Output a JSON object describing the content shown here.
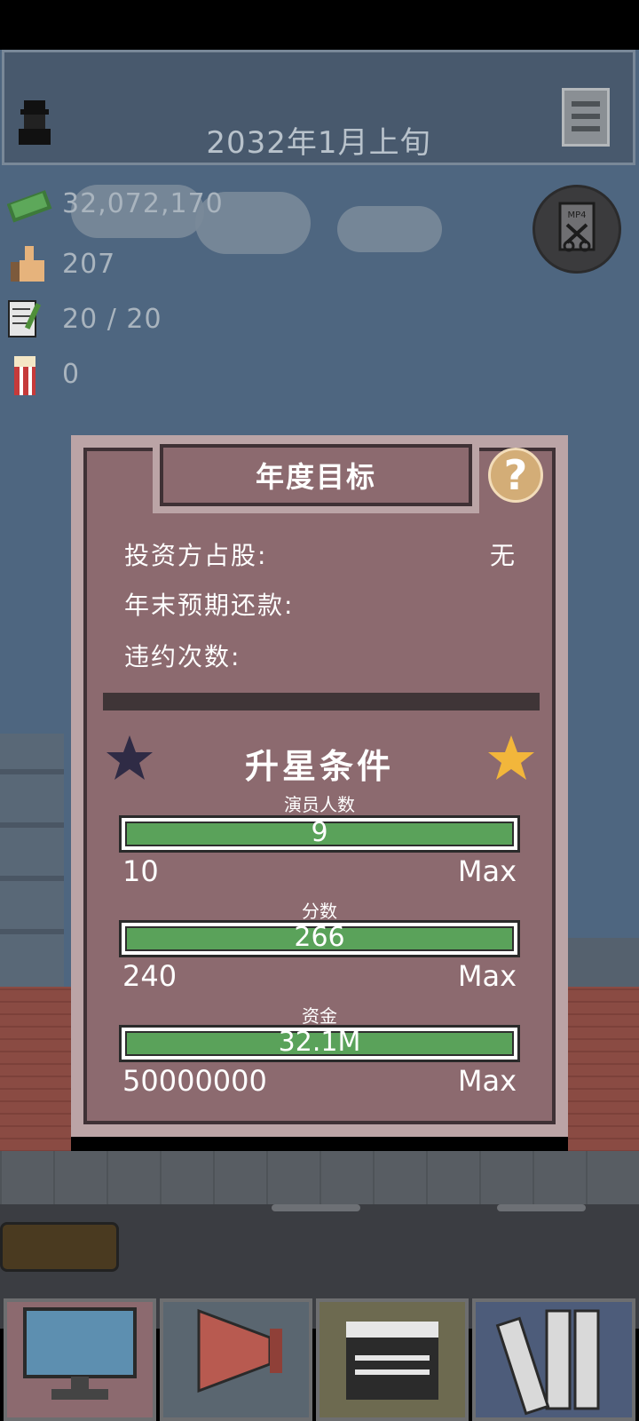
{
  "header": {
    "date": "2032年1月上旬"
  },
  "stats": {
    "money": "32,072,170",
    "likes": "207",
    "scripts": "20 / 20",
    "popcorn": "0"
  },
  "dialog": {
    "title": "年度目标",
    "help": "?",
    "rows": [
      {
        "label": "投资方占股:",
        "value": "无"
      },
      {
        "label": "年末预期还款:",
        "value": ""
      },
      {
        "label": "违约次数:",
        "value": ""
      }
    ],
    "upgrade_title": "升星条件",
    "conditions": [
      {
        "label": "演员人数",
        "current": "9",
        "min": "10",
        "max": "Max",
        "progress": 1.0
      },
      {
        "label": "分数",
        "current": "266",
        "min": "240",
        "max": "Max",
        "progress": 1.0
      },
      {
        "label": "资金",
        "current": "32.1M",
        "min": "50000000",
        "max": "Max",
        "progress": 1.0
      }
    ]
  },
  "colors": {
    "panel": "#8c6a6f",
    "panel_border": "#bba4a6",
    "progress_fill": "#5aa25a",
    "star_empty": "#2f2b45",
    "star_filled": "#f2b63b"
  },
  "bottom_nav": [
    {
      "icon": "computer-icon"
    },
    {
      "icon": "megaphone-icon"
    },
    {
      "icon": "clapperboard-icon"
    },
    {
      "icon": "film-reels-icon"
    }
  ]
}
